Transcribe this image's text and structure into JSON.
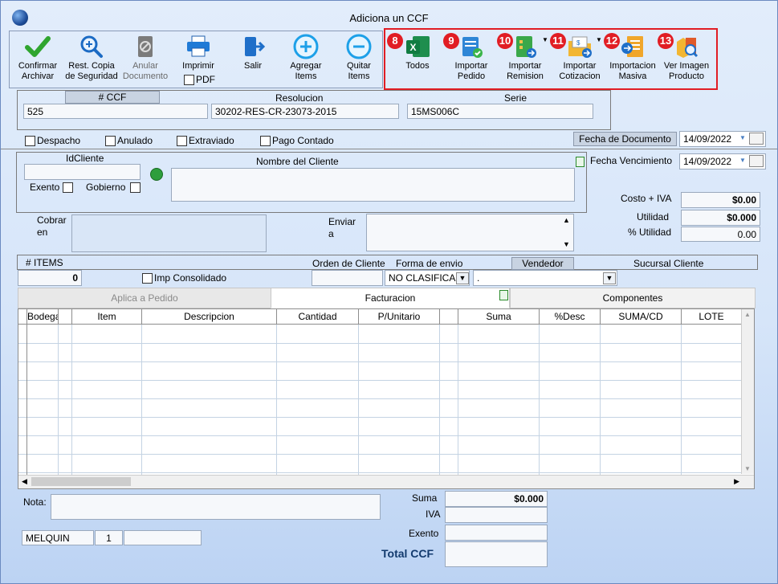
{
  "window": {
    "title": "Adiciona un CCF"
  },
  "toolbar": {
    "confirmar": [
      "Confirmar",
      "Archivar"
    ],
    "rest_copia": [
      "Rest. Copia",
      "de Seguridad"
    ],
    "anular": [
      "Anular",
      "Documento"
    ],
    "imprimir": "Imprimir",
    "pdf": "PDF",
    "salir": "Salir",
    "agregar": [
      "Agregar",
      "Items"
    ],
    "quitar": [
      "Quitar",
      "Items"
    ],
    "todos": "Todos",
    "imp_pedido": [
      "Importar",
      "Pedido"
    ],
    "imp_remision": [
      "Importar",
      "Remision"
    ],
    "imp_cotizacion": [
      "Importar",
      "Cotizacion"
    ],
    "imp_masiva": [
      "Importacion",
      "Masiva"
    ],
    "ver_imagen": [
      "Ver Imagen",
      "Producto"
    ],
    "badges": [
      "8",
      "9",
      "10",
      "11",
      "12",
      "13"
    ],
    "highlight_color": "#e11d24"
  },
  "doc": {
    "ccf_label": "# CCF",
    "ccf": "525",
    "resolucion_label": "Resolucion",
    "resolucion": "30202-RES-CR-23073-2015",
    "serie_label": "Serie",
    "serie": "15MS006C"
  },
  "flags": {
    "despacho": "Despacho",
    "anulado": "Anulado",
    "extraviado": "Extraviado",
    "pago_contado": "Pago Contado"
  },
  "fechas": {
    "doc_label": "Fecha de  Documento",
    "doc_value": "14/09/2022",
    "venc_label": "Fecha Vencimiento",
    "venc_value": "14/09/2022"
  },
  "cliente": {
    "id_label": "IdCliente",
    "nombre_label": "Nombre del Cliente",
    "exento": "Exento",
    "gobierno": "Gobierno"
  },
  "costos": {
    "costo_label": "Costo + IVA",
    "costo": "$0.00",
    "utilidad_label": "Utilidad",
    "utilidad": "$0.000",
    "pct_label": "% Utilidad",
    "pct": "0.00"
  },
  "envio": {
    "cobrar": [
      "Cobrar",
      "en"
    ],
    "enviar": [
      "Enviar",
      "a"
    ]
  },
  "items": {
    "label": "# ITEMS",
    "count": "0",
    "imp_consolidado": "Imp Consolidado",
    "orden_label": "Orden de Cliente",
    "forma_label": "Forma de envio",
    "forma_value": "NO CLASIFICAD",
    "vendedor_label": "Vendedor",
    "vendedor_value": ".",
    "sucursal_label": "Sucursal Cliente"
  },
  "tabs": [
    "Aplica a Pedido",
    "Facturacion",
    "Componentes"
  ],
  "grid_columns": [
    "Bodega",
    "",
    "Item",
    "Descripcion",
    "Cantidad",
    "P/Unitario",
    "",
    "Suma",
    "%Desc",
    "SUMA/CD",
    "LOTE"
  ],
  "footer": {
    "nota_label": "Nota:",
    "user": "MELQUIN",
    "user_num": "1",
    "suma_label": "Suma",
    "suma": "$0.000",
    "iva_label": "IVA",
    "exento_label": "Exento",
    "total_label": "Total CCF"
  }
}
